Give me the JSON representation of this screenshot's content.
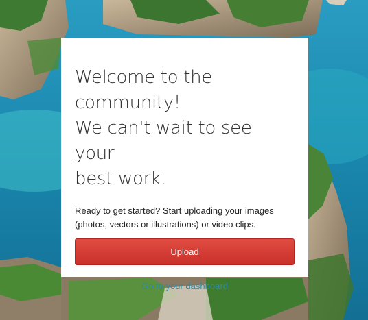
{
  "card": {
    "headline": [
      "Welcome to the",
      "community!",
      "We can't wait to see your",
      "best work."
    ],
    "intro": "Ready to get started? Start uploading your images (photos, vectors or illustrations) or video clips.",
    "upload_label": "Upload",
    "dashboard_link": "Go to your dashboard"
  },
  "colors": {
    "upload_button": "#d33b32",
    "link": "#2b8aa8",
    "sea": "#1f8fb4"
  }
}
